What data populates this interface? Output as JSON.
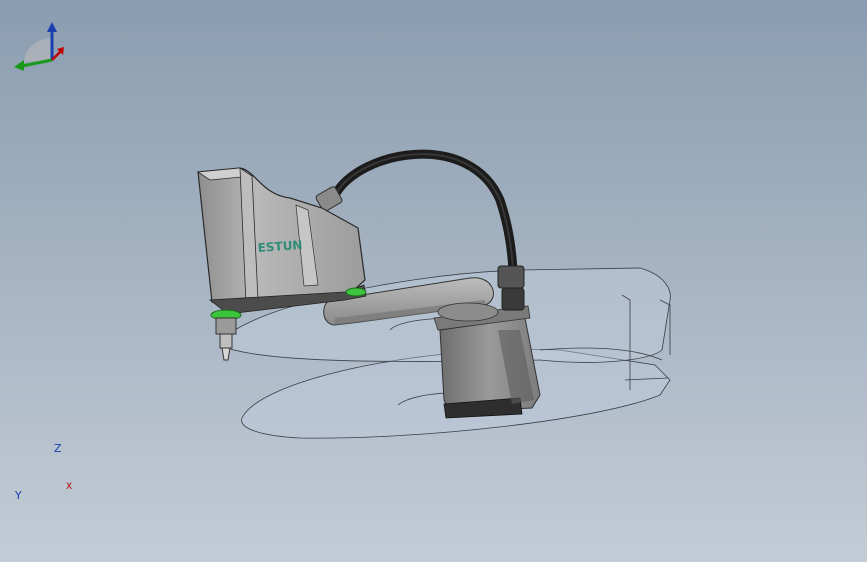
{
  "viewport": {
    "model_logo_text": "ESTUN",
    "colors": {
      "background_top": "#8a9db0",
      "background_bottom": "#c3ccd6",
      "body_grey": "#a6a6a6",
      "accent_green": "#3cc43c",
      "logo_green": "#2f8c78",
      "cable_black": "#1c1c1c"
    }
  },
  "triad": {
    "z_label": "Z",
    "y_label": "Y",
    "x_label": "X",
    "colors": {
      "z": "#1a3fb0",
      "y": "#1a9a1a",
      "x": "#c00000"
    }
  }
}
